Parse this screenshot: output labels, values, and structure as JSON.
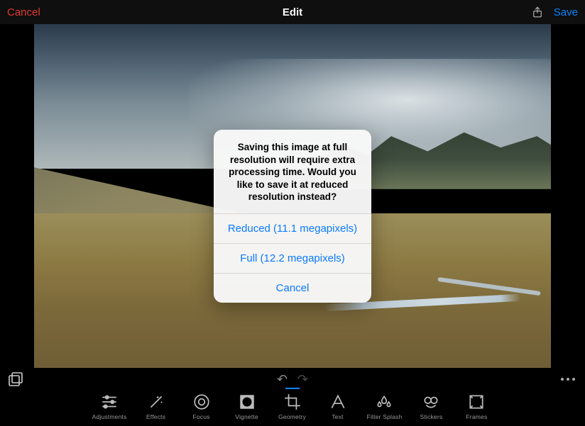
{
  "nav": {
    "cancel": "Cancel",
    "title": "Edit",
    "save": "Save"
  },
  "sheet": {
    "message": "Saving this image at full resolution will require extra processing time.  Would you like to save it at reduced resolution instead?",
    "reduced": "Reduced (11.1 megapixels)",
    "full": "Full (12.2 megapixels)",
    "cancel": "Cancel"
  },
  "tools": {
    "adjustments": "Adjustments",
    "effects": "Effects",
    "focus": "Focus",
    "vignette": "Vignette",
    "geometry": "Geometry",
    "text": "Text",
    "filter_splash": "Filter Splash",
    "stickers": "Stickers",
    "frames": "Frames"
  },
  "active_tool": "geometry"
}
